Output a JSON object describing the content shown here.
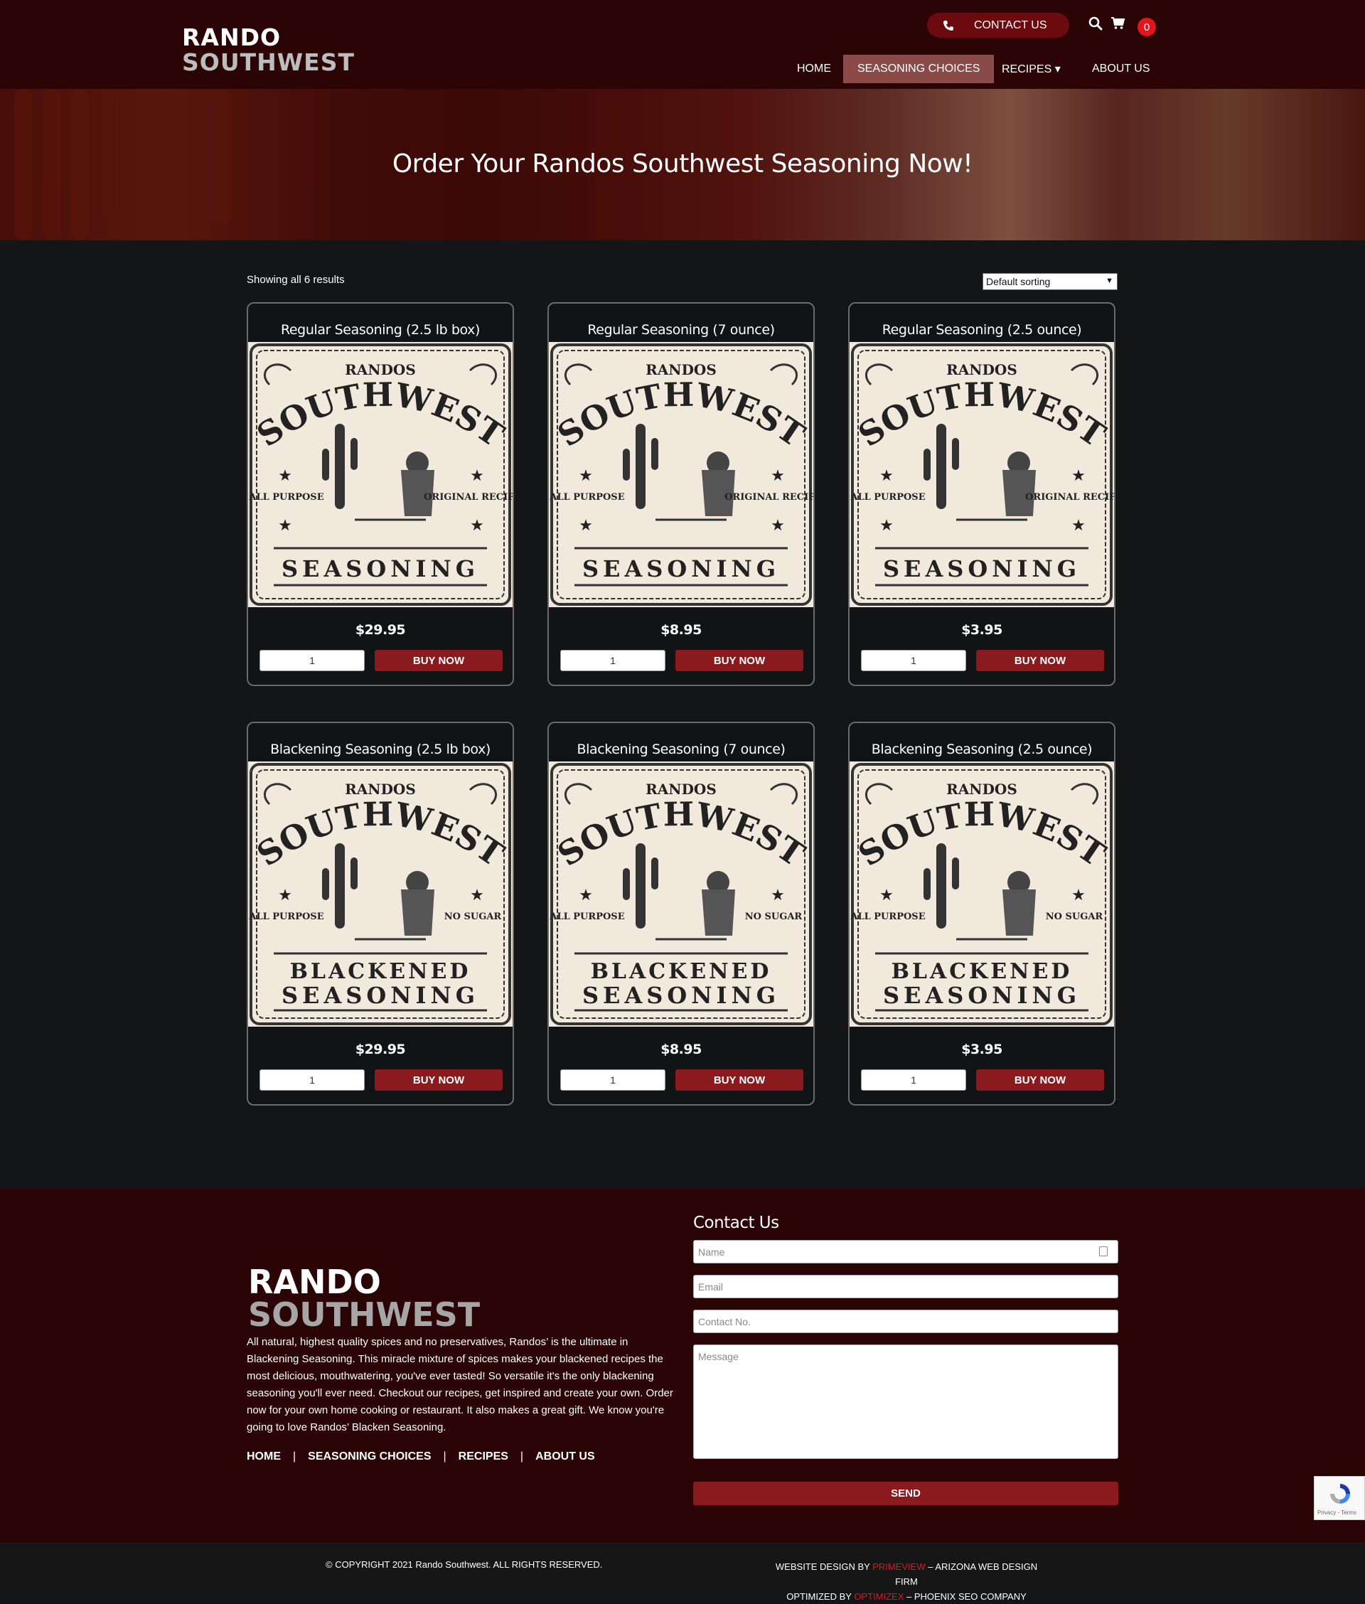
{
  "header": {
    "logo_line1": "RANDO",
    "logo_line2": "SOUTHWEST",
    "contact_label": "CONTACT US",
    "cart_count": "0",
    "nav": [
      {
        "label": "HOME"
      },
      {
        "label": "SEASONING CHOICES",
        "active": true
      },
      {
        "label": "RECIPES ▾"
      },
      {
        "label": "ABOUT US"
      }
    ]
  },
  "hero": {
    "title": "Order Your  Randos Southwest Seasoning  Now!"
  },
  "shop": {
    "results_text": "Showing all 6 results",
    "sort_selected": "Default sorting",
    "buy_label": "BUY NOW",
    "qty_default": "1",
    "products": [
      {
        "title": "Regular Seasoning (2.5 lb box)",
        "price": "$29.95",
        "label_top": "RANDOS",
        "label_arc": "SOUTHWEST",
        "left_text": "ALL PURPOSE",
        "right_text": "ORIGINAL RECIPE",
        "bottom1": "",
        "bottom2": "SEASONING"
      },
      {
        "title": "Regular Seasoning (7 ounce)",
        "price": "$8.95",
        "label_top": "RANDOS",
        "label_arc": "SOUTHWEST",
        "left_text": "ALL PURPOSE",
        "right_text": "ORIGINAL RECIPE",
        "bottom1": "",
        "bottom2": "SEASONING"
      },
      {
        "title": "Regular Seasoning (2.5 ounce)",
        "price": "$3.95",
        "label_top": "RANDOS",
        "label_arc": "SOUTHWEST",
        "left_text": "ALL PURPOSE",
        "right_text": "ORIGINAL RECIPE",
        "bottom1": "",
        "bottom2": "SEASONING"
      },
      {
        "title": "Blackening Seasoning (2.5 lb box)",
        "price": "$29.95",
        "label_top": "RANDOS",
        "label_arc": "SOUTHWEST",
        "left_text": "ALL PURPOSE",
        "right_text": "NO SUGAR",
        "bottom1": "BLACKENED",
        "bottom2": "SEASONING"
      },
      {
        "title": "Blackening Seasoning (7 ounce)",
        "price": "$8.95",
        "label_top": "RANDOS",
        "label_arc": "SOUTHWEST",
        "left_text": "ALL PURPOSE",
        "right_text": "NO SUGAR",
        "bottom1": "BLACKENED",
        "bottom2": "SEASONING"
      },
      {
        "title": "Blackening Seasoning (2.5 ounce)",
        "price": "$3.95",
        "label_top": "RANDOS",
        "label_arc": "SOUTHWEST",
        "left_text": "ALL PURPOSE",
        "right_text": "NO SUGAR",
        "bottom1": "BLACKENED",
        "bottom2": "SEASONING"
      }
    ]
  },
  "footer": {
    "logo_line1": "RANDO",
    "logo_line2": "SOUTHWEST",
    "description": "All natural, highest quality spices and no preservatives,  Randos’ is the ultimate in Blackening Seasoning. This miracle mixture of spices makes your blackened recipes the most delicious, mouthwatering, you've ever tasted! So versatile it's the only blackening seasoning you'll ever need. Checkout our recipes, get inspired and create your own. Order now for your own home cooking or restaurant.  It also makes a great gift. We know you're going to love  Randos’ Blacken Seasoning.",
    "links": [
      "HOME",
      "SEASONING CHOICES",
      "RECIPES",
      "ABOUT US"
    ],
    "contact_title": "Contact Us",
    "name_placeholder": "Name",
    "email_placeholder": "Email",
    "phone_placeholder": "Contact No.",
    "message_placeholder": "Message",
    "send_label": "SEND"
  },
  "bottom": {
    "copyright": "© COPYRIGHT 2021  Rando Southwest. ALL  RIGHTS  RESERVED.",
    "design_prefix": "WEBSITE  DESIGN  BY ",
    "design_brand": "PRIMEVIEW",
    "design_suffix": " – ARIZONA WEB DESIGN FIRM",
    "opt_prefix": "OPTIMIZED  BY ",
    "opt_brand": "OPTIMIZEX",
    "opt_suffix": " –  PHOENIX SEO COMPANY"
  },
  "recaptcha": {
    "text": "Privacy - Terms"
  }
}
